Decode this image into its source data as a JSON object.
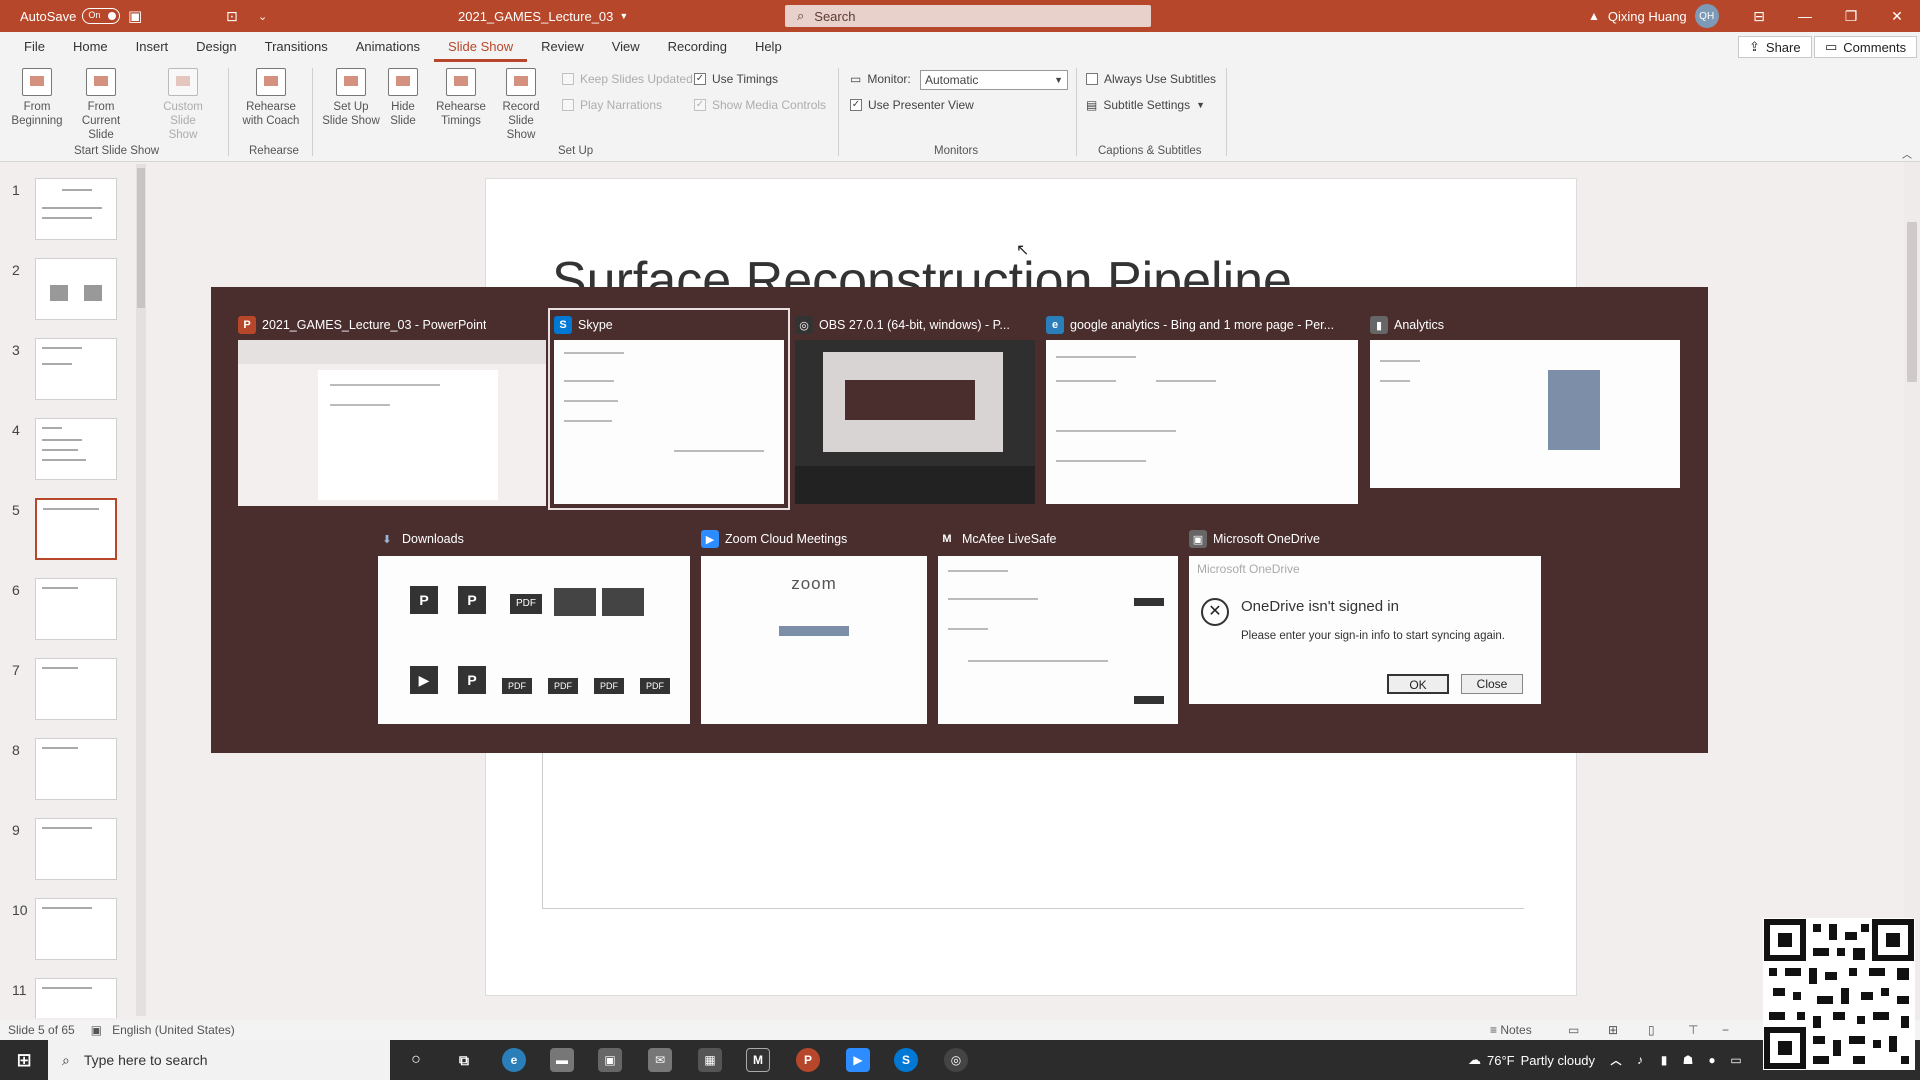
{
  "titlebar": {
    "autosave_label": "AutoSave",
    "autosave_state": "On",
    "doc_title": "2021_GAMES_Lecture_03",
    "search_placeholder": "Search",
    "user_name": "Qixing Huang",
    "user_initials": "QH"
  },
  "menu": {
    "tabs": [
      "File",
      "Home",
      "Insert",
      "Design",
      "Transitions",
      "Animations",
      "Slide Show",
      "Review",
      "View",
      "Recording",
      "Help"
    ],
    "active_tab": "Slide Show",
    "share_label": "Share",
    "comments_label": "Comments"
  },
  "ribbon": {
    "buttons": [
      {
        "line1": "From",
        "line2": "Beginning"
      },
      {
        "line1": "From",
        "line2": "Current Slide"
      },
      {
        "line1": "Custom Slide",
        "line2": "Show"
      },
      {
        "line1": "Rehearse",
        "line2": "with Coach"
      },
      {
        "line1": "Set Up",
        "line2": "Slide Show"
      },
      {
        "line1": "Hide",
        "line2": "Slide"
      },
      {
        "line1": "Rehearse",
        "line2": "Timings"
      },
      {
        "line1": "Record Slide",
        "line2": "Show"
      }
    ],
    "groups": [
      "Start Slide Show",
      "Rehearse",
      "Set Up",
      "Monitors",
      "Captions & Subtitles"
    ],
    "checkboxes": {
      "keep_slides_updated": "Keep Slides Updated",
      "use_timings": "Use Timings",
      "play_narrations": "Play Narrations",
      "show_media_controls": "Show Media Controls",
      "use_presenter_view": "Use Presenter View",
      "always_use_subtitles": "Always Use Subtitles"
    },
    "monitor_label": "Monitor:",
    "monitor_value": "Automatic",
    "subtitle_settings": "Subtitle Settings"
  },
  "slides": {
    "numbers": [
      "1",
      "2",
      "3",
      "4",
      "5",
      "6",
      "7",
      "8",
      "9",
      "10",
      "11"
    ],
    "selected_index": 5
  },
  "slide": {
    "title": "Surface Reconstruction Pipeline"
  },
  "switcher": {
    "windows_row1": [
      {
        "title": "2021_GAMES_Lecture_03 - PowerPoint",
        "icon": "powerpoint-icon",
        "color": "#b7472a",
        "glyph": "P"
      },
      {
        "title": "Skype",
        "icon": "skype-icon",
        "color": "#0078d4",
        "glyph": "S"
      },
      {
        "title": "OBS 27.0.1 (64-bit, windows) - P...",
        "icon": "obs-icon",
        "color": "#333333",
        "glyph": "◎"
      },
      {
        "title": "google analytics - Bing and 1 more page - Per...",
        "icon": "edge-icon",
        "color": "#2a7fba",
        "glyph": "e"
      },
      {
        "title": "Analytics",
        "icon": "analytics-icon",
        "color": "#666666",
        "glyph": "▮"
      }
    ],
    "windows_row2": [
      {
        "title": "Downloads",
        "icon": "downloads-icon",
        "color": "#4a2e2e",
        "glyph": "⬇"
      },
      {
        "title": "Zoom Cloud Meetings",
        "icon": "zoom-icon",
        "color": "#2d8cff",
        "glyph": "▶"
      },
      {
        "title": "McAfee LiveSafe",
        "icon": "mcafee-icon",
        "color": "#4a2e2e",
        "glyph": "M"
      },
      {
        "title": "Microsoft OneDrive",
        "icon": "onedrive-icon",
        "color": "#666666",
        "glyph": "▣"
      }
    ],
    "zoom_logo": "zoom",
    "onedrive": {
      "header": "Microsoft OneDrive",
      "title": "OneDrive isn't signed in",
      "message": "Please enter your sign-in info to start syncing again.",
      "ok": "OK",
      "close": "Close"
    },
    "pdf_label": "PDF"
  },
  "statusbar": {
    "slide_of": "Slide 5 of 65",
    "language": "English (United States)",
    "notes": "Notes"
  },
  "taskbar": {
    "search_placeholder": "Type here to search",
    "temperature": "76°F",
    "weather": "Partly cloudy"
  },
  "colors": {
    "accent": "#b7472a",
    "switcher_bg": "#4a2e2e",
    "taskbar": "#2c2c2c"
  }
}
